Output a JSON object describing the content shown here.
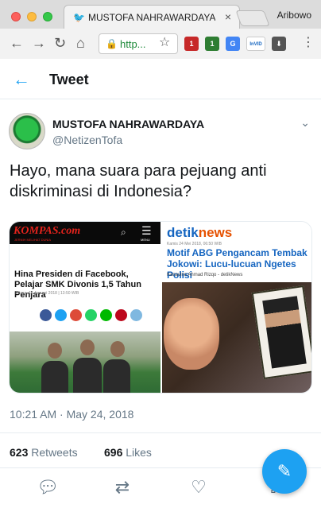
{
  "browser": {
    "tab_title": "MUSTOFA NAHRAWARDAYA",
    "tab_close": "×",
    "profile_name": "Aribowo",
    "url": "http...",
    "extensions": [
      {
        "name": "ublock-badge",
        "color": "#c62828",
        "badge": "1"
      },
      {
        "name": "green-ext",
        "color": "#2e7d32",
        "badge": "1"
      },
      {
        "name": "translate-ext",
        "color": "#4285f4",
        "badge": "G"
      },
      {
        "name": "invid-ext",
        "color": "#ffffff",
        "badge": "InVID"
      },
      {
        "name": "download-ext",
        "color": "#555555",
        "badge": "⬇"
      }
    ]
  },
  "header": {
    "title": "Tweet"
  },
  "tweet": {
    "display_name": "MUSTOFA NAHRAWARDAYA",
    "handle": "@NetizenTofa",
    "text": "Hayo, mana suara para pejuang anti diskriminasi di Indonesia?",
    "timestamp": "10:21 AM · May 24, 2018",
    "retweets_count": "623",
    "retweets_label": "Retweets",
    "likes_count": "696",
    "likes_label": "Likes"
  },
  "media": {
    "left": {
      "logo": "KOMPAS.com",
      "tagline": "JERNIH MELIHAT DUNIA",
      "menu_label": "MENU",
      "headline": "Hina Presiden di Facebook, Pelajar SMK Divonis 1,5 Tahun Penjara",
      "date": "Selasa, 16 Januari 2018 | 13:50 WIB"
    },
    "right": {
      "logo_a": "detik",
      "logo_b": "news",
      "date": "Kamis 24 Mei 2018, 06:50 WIB",
      "headline": "Motif ABG Pengancam Tembak Jokowi: Lucu-lucuan Ngetes Polisi",
      "author": "Kanavino Ahmad Rizqo - detikNews"
    }
  },
  "colors": {
    "accent": "#1da1f2",
    "secondary_text": "#657786"
  }
}
